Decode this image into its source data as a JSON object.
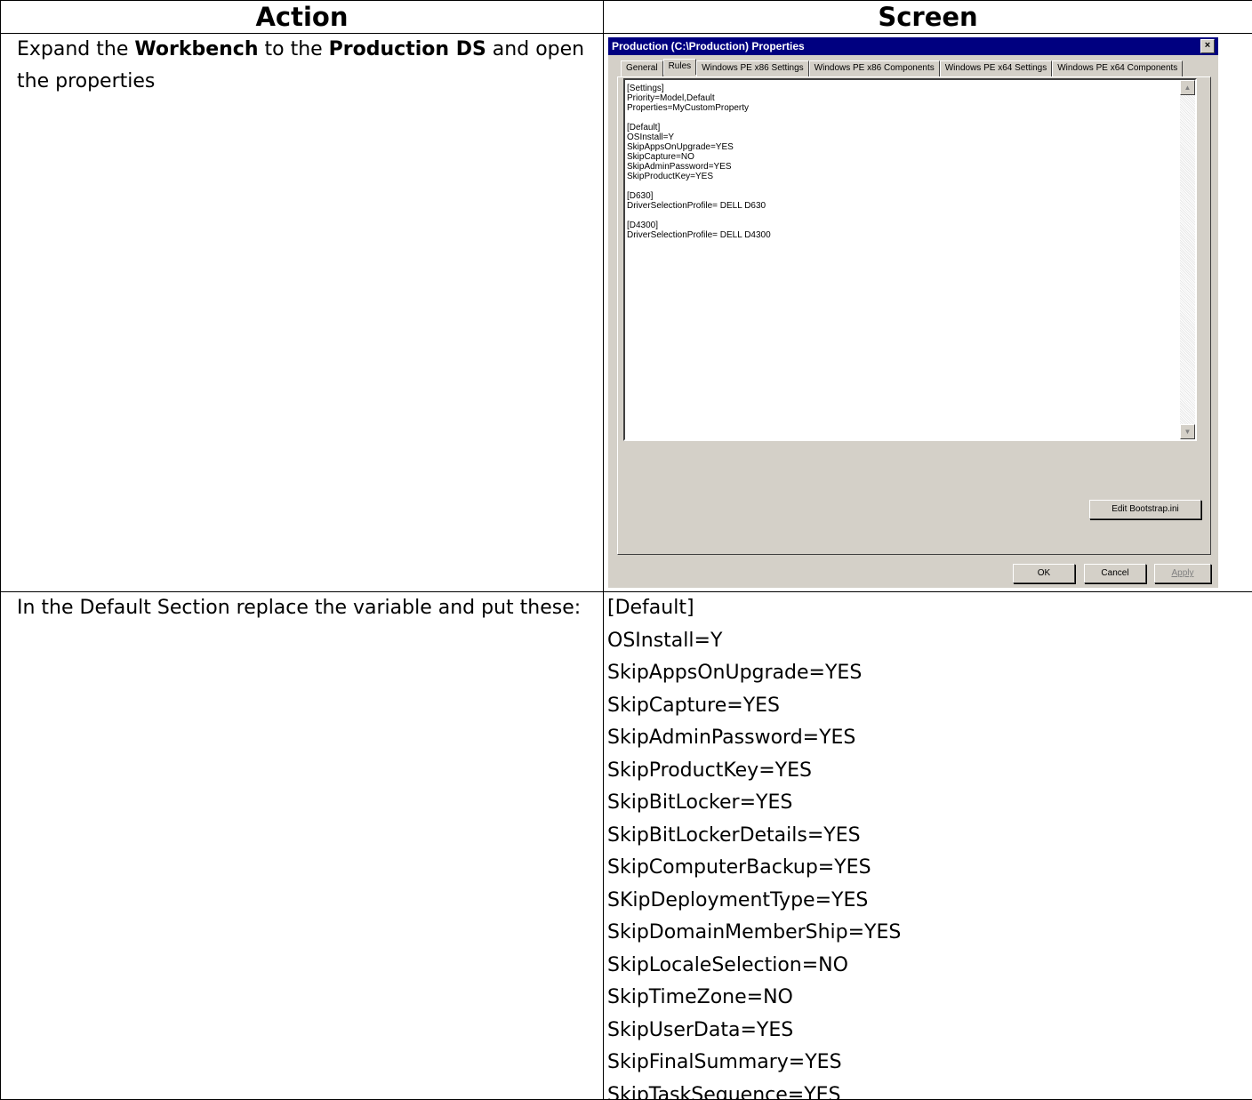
{
  "headers": {
    "action": "Action",
    "screen": "Screen"
  },
  "row1": {
    "action": {
      "part1": "Expand the ",
      "bold1": "Workbench",
      "part2": " to the ",
      "bold2": "Production DS",
      "part3": " and open the properties"
    },
    "dialog": {
      "title": "Production (C:\\Production) Properties",
      "close": "×",
      "tabs": [
        "General",
        "Rules",
        "Windows PE x86 Settings",
        "Windows PE x86 Components",
        "Windows PE x64 Settings",
        "Windows PE x64 Components"
      ],
      "editor_lines": "[Settings]\nPriority=Model,Default\nProperties=MyCustomProperty\n\n[Default]\nOSInstall=Y\nSkipAppsOnUpgrade=YES\nSkipCapture=NO\nSkipAdminPassword=YES\nSkipProductKey=YES\n\n[D630]\nDriverSelectionProfile= DELL D630\n\n[D4300]\nDriverSelectionProfile= DELL D4300",
      "edit_bootstrap_label": "Edit Bootstrap.ini",
      "ok_label": "OK",
      "cancel_label": "Cancel",
      "apply_label": "Apply"
    }
  },
  "row2": {
    "action": "In the Default Section replace the variable and put these:",
    "lines": [
      "[Default]",
      "OSInstall=Y",
      "SkipAppsOnUpgrade=YES",
      "SkipCapture=YES",
      "SkipAdminPassword=YES",
      "SkipProductKey=YES",
      "SkipBitLocker=YES",
      "SkipBitLockerDetails=YES",
      "SkipComputerBackup=YES",
      "SKipDeploymentType=YES",
      "SkipDomainMemberShip=YES",
      "SkipLocaleSelection=NO",
      "SkipTimeZone=NO",
      "SkipUserData=YES",
      "SkipFinalSummary=YES",
      "SkipTaskSequence=YES"
    ]
  }
}
